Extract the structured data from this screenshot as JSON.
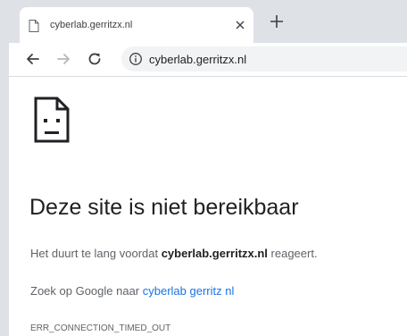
{
  "tab": {
    "title": "cyberlab.gerritzx.nl",
    "close_glyph": "×",
    "icons": {
      "favicon": "page-icon",
      "close": "close-icon"
    }
  },
  "newtab": {
    "glyph": "+",
    "icon": "plus-icon"
  },
  "toolbar": {
    "back_icon": "arrow-left-icon",
    "forward_icon": "arrow-right-icon",
    "reload_icon": "reload-icon",
    "info_icon": "info-icon",
    "url": "cyberlab.gerritzx.nl"
  },
  "error": {
    "icon": "sad-page-icon",
    "heading": "Deze site is niet bereikbaar",
    "message_prefix": "Het duurt te lang voordat ",
    "message_host": "cyberlab.gerritzx.nl",
    "message_suffix": " reageert.",
    "suggest_prefix": "Zoek op Google naar ",
    "suggest_link": "cyberlab gerritz nl",
    "code": "ERR_CONNECTION_TIMED_OUT"
  },
  "colors": {
    "chrome_frame": "#dee1e6",
    "omnibox": "#f1f3f4",
    "link": "#1a73e8",
    "text_secondary": "#5f6368"
  }
}
